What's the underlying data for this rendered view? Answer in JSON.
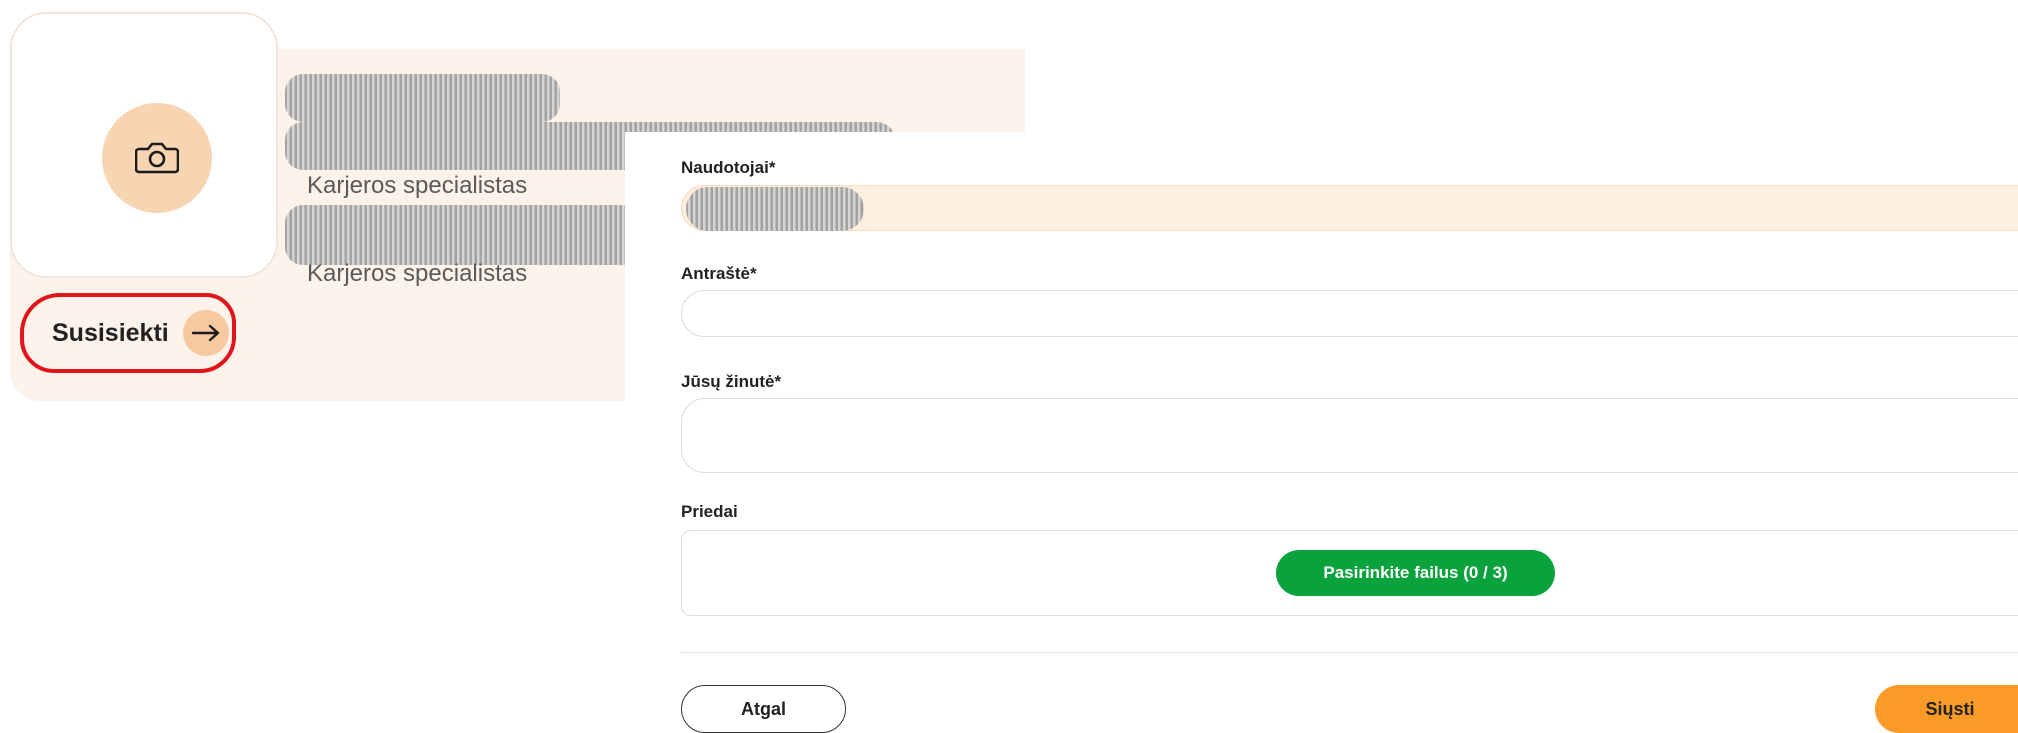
{
  "profile_card": {
    "role_1": "Karjeros specialistas",
    "role_2": "Karjeros specialistas",
    "contact_label": "Susisiekti",
    "photo_icon": "camera-icon",
    "contact_icon": "arrow-right-icon",
    "highlight_color": "#e0141b"
  },
  "form": {
    "users_label": "Naudotojai*",
    "title_label": "Antraštė*",
    "title_value": "",
    "message_label": "Jūsų žinutė*",
    "message_value": "",
    "attachments_label": "Priedai",
    "choose_files_label": "Pasirinkite failus (0 / 3)",
    "back_label": "Atgal",
    "send_label": "Siųsti"
  },
  "colors": {
    "accent_orange": "#fb9b27",
    "accent_green": "#0aa23c",
    "card_background": "#fdf3ea"
  }
}
